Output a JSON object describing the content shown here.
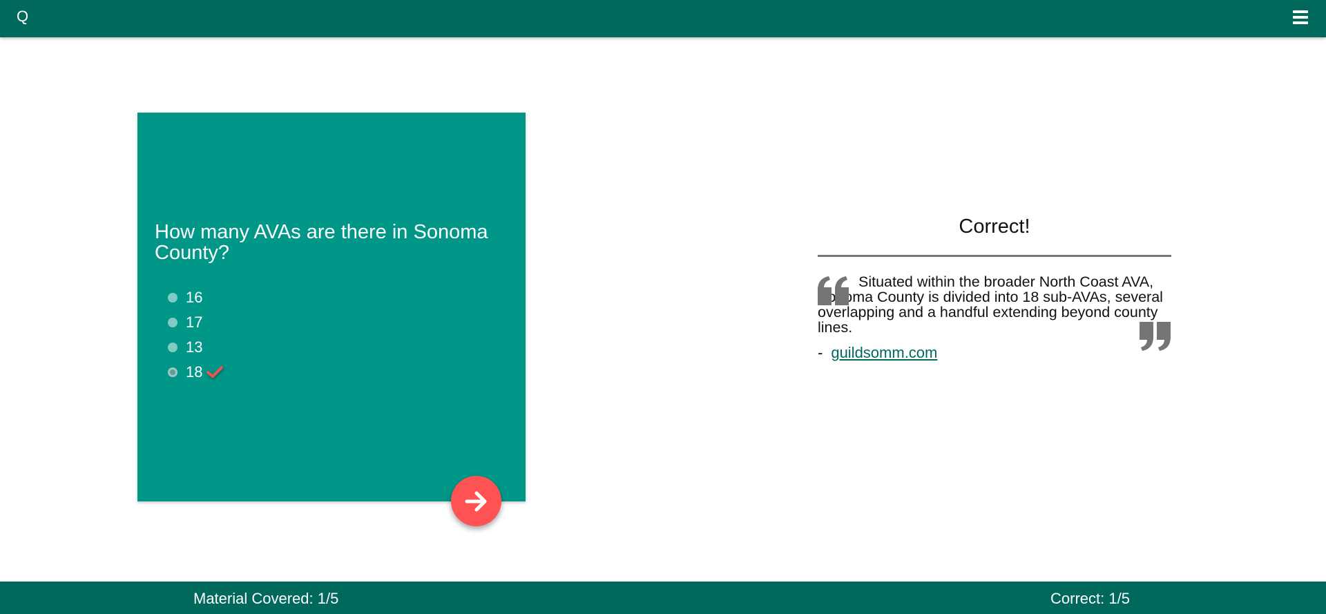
{
  "header": {
    "logo": "Q",
    "menu_icon": "hamburger-menu-icon"
  },
  "question": {
    "text": "How many AVAs are there in Sonoma County?",
    "options": [
      {
        "label": "16",
        "selected": false
      },
      {
        "label": "17",
        "selected": false
      },
      {
        "label": "13",
        "selected": false
      },
      {
        "label": "18",
        "selected": true,
        "correct": true
      }
    ],
    "next_icon": "arrow-right-icon"
  },
  "result": {
    "title": "Correct!",
    "quote": "Situated within the broader North Coast AVA, Sonoma County is divided into 18 sub-AVAs, several overlapping and a handful extending beyond county lines.",
    "source_dash": "-",
    "source_link": "guildsomm.com"
  },
  "footer": {
    "material_covered": "Material Covered: 1/5",
    "correct": "Correct: 1/5"
  },
  "colors": {
    "primary_dark": "#00695c",
    "card": "#009688",
    "accent": "#ff5252",
    "check": "#ef5350",
    "quote_marks": "#757575"
  }
}
